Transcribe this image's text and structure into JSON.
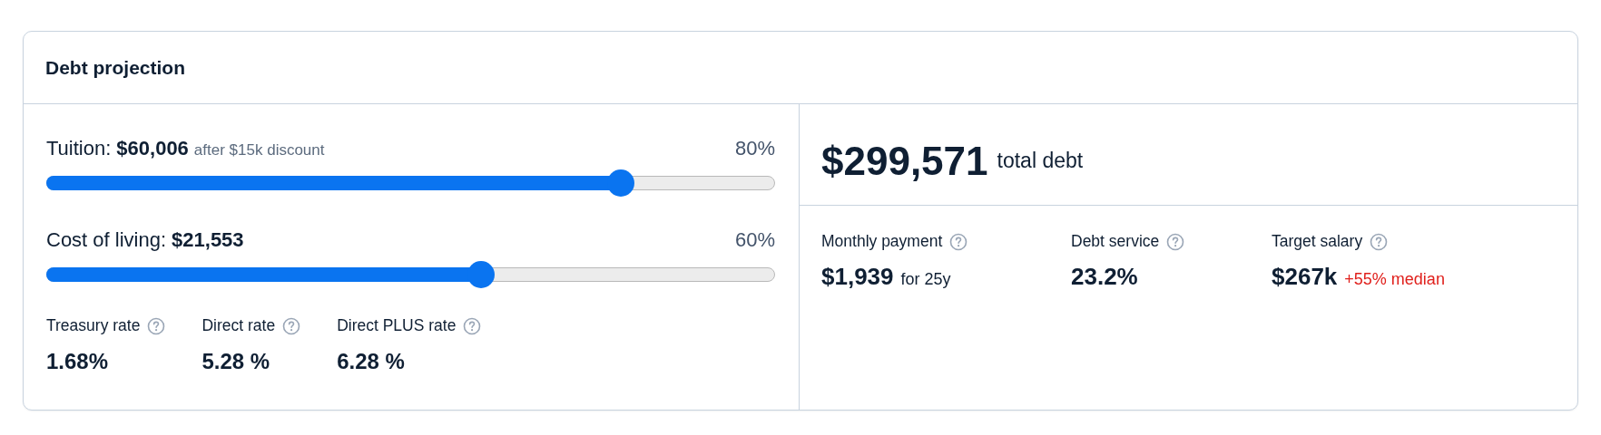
{
  "title": "Debt projection",
  "sliders": [
    {
      "label": "Tuition:",
      "value": "$60,006",
      "note": "after $15k discount",
      "percent": "80%",
      "level": 0.8
    },
    {
      "label": "Cost of living:",
      "value": "$21,553",
      "percent": "60%",
      "level": 0.6
    }
  ],
  "rates": [
    {
      "label": "Treasury rate",
      "value": "1.68%"
    },
    {
      "label": "Direct rate",
      "value": "5.28 %"
    },
    {
      "label": "Direct PLUS rate",
      "value": "6.28 %"
    }
  ],
  "total": {
    "value": "$299,571",
    "label": "total debt"
  },
  "metrics": [
    {
      "label": "Monthly payment",
      "value": "$1,939",
      "note": "for 25y",
      "kind": "plain"
    },
    {
      "label": "Debt service",
      "value": "23.2%"
    },
    {
      "label": "Target salary",
      "value": "$267k",
      "note": "+55% median",
      "kind": "alert"
    }
  ]
}
